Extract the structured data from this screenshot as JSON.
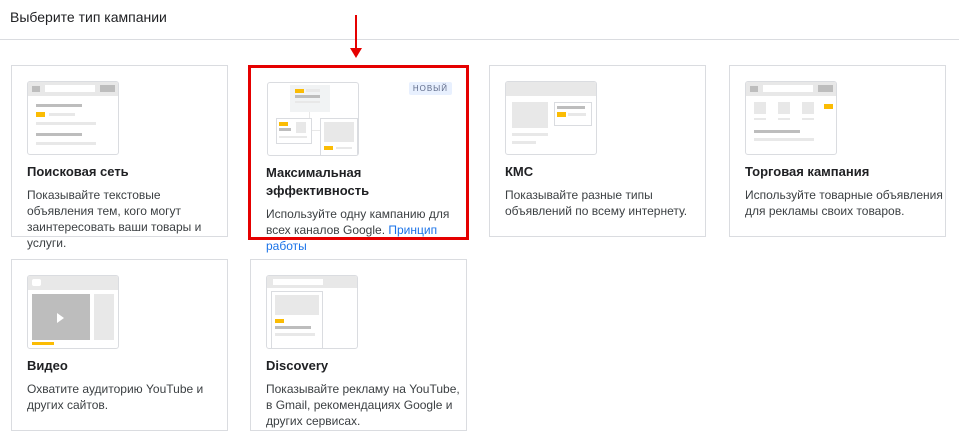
{
  "header": {
    "title": "Выберите тип кампании"
  },
  "cards": [
    {
      "title": "Поисковая сеть",
      "description": "Показывайте текстовые объявления тем, кого могут заинтересовать ваши товары и услуги."
    },
    {
      "title": "Максимальная эффективность",
      "description": "Используйте одну кампанию для всех каналов Google.",
      "link": "Принцип работы",
      "badge": "НОВЫЙ",
      "selected": true
    },
    {
      "title": "КМС",
      "description": "Показывайте разные типы объявлений по всему интернету."
    },
    {
      "title": "Торговая кампания",
      "description": "Используйте товарные объявления для рекламы своих товаров."
    },
    {
      "title": "Видео",
      "description": "Охватите аудиторию YouTube и других сайтов."
    },
    {
      "title": "Discovery",
      "description": "Показывайте рекламу на YouTube, в Gmail, рекомендациях Google и других сервисах."
    }
  ],
  "colors": {
    "accent": "#fbbc04",
    "highlight": "#e50000",
    "link": "#1a73e8"
  }
}
